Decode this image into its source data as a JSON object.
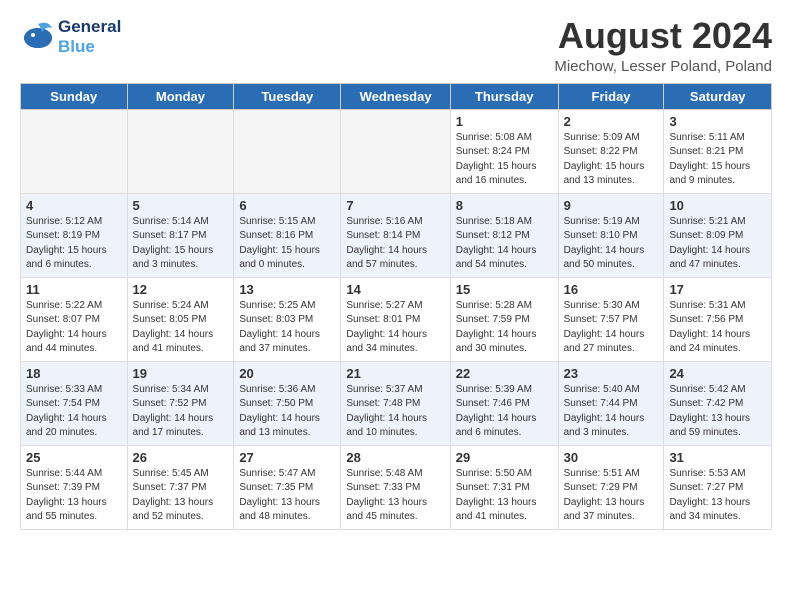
{
  "header": {
    "logo_line1": "General",
    "logo_line2": "Blue",
    "title": "August 2024",
    "location": "Miechow, Lesser Poland, Poland"
  },
  "weekdays": [
    "Sunday",
    "Monday",
    "Tuesday",
    "Wednesday",
    "Thursday",
    "Friday",
    "Saturday"
  ],
  "weeks": [
    [
      {
        "day": "",
        "info": ""
      },
      {
        "day": "",
        "info": ""
      },
      {
        "day": "",
        "info": ""
      },
      {
        "day": "",
        "info": ""
      },
      {
        "day": "1",
        "info": "Sunrise: 5:08 AM\nSunset: 8:24 PM\nDaylight: 15 hours\nand 16 minutes."
      },
      {
        "day": "2",
        "info": "Sunrise: 5:09 AM\nSunset: 8:22 PM\nDaylight: 15 hours\nand 13 minutes."
      },
      {
        "day": "3",
        "info": "Sunrise: 5:11 AM\nSunset: 8:21 PM\nDaylight: 15 hours\nand 9 minutes."
      }
    ],
    [
      {
        "day": "4",
        "info": "Sunrise: 5:12 AM\nSunset: 8:19 PM\nDaylight: 15 hours\nand 6 minutes."
      },
      {
        "day": "5",
        "info": "Sunrise: 5:14 AM\nSunset: 8:17 PM\nDaylight: 15 hours\nand 3 minutes."
      },
      {
        "day": "6",
        "info": "Sunrise: 5:15 AM\nSunset: 8:16 PM\nDaylight: 15 hours\nand 0 minutes."
      },
      {
        "day": "7",
        "info": "Sunrise: 5:16 AM\nSunset: 8:14 PM\nDaylight: 14 hours\nand 57 minutes."
      },
      {
        "day": "8",
        "info": "Sunrise: 5:18 AM\nSunset: 8:12 PM\nDaylight: 14 hours\nand 54 minutes."
      },
      {
        "day": "9",
        "info": "Sunrise: 5:19 AM\nSunset: 8:10 PM\nDaylight: 14 hours\nand 50 minutes."
      },
      {
        "day": "10",
        "info": "Sunrise: 5:21 AM\nSunset: 8:09 PM\nDaylight: 14 hours\nand 47 minutes."
      }
    ],
    [
      {
        "day": "11",
        "info": "Sunrise: 5:22 AM\nSunset: 8:07 PM\nDaylight: 14 hours\nand 44 minutes."
      },
      {
        "day": "12",
        "info": "Sunrise: 5:24 AM\nSunset: 8:05 PM\nDaylight: 14 hours\nand 41 minutes."
      },
      {
        "day": "13",
        "info": "Sunrise: 5:25 AM\nSunset: 8:03 PM\nDaylight: 14 hours\nand 37 minutes."
      },
      {
        "day": "14",
        "info": "Sunrise: 5:27 AM\nSunset: 8:01 PM\nDaylight: 14 hours\nand 34 minutes."
      },
      {
        "day": "15",
        "info": "Sunrise: 5:28 AM\nSunset: 7:59 PM\nDaylight: 14 hours\nand 30 minutes."
      },
      {
        "day": "16",
        "info": "Sunrise: 5:30 AM\nSunset: 7:57 PM\nDaylight: 14 hours\nand 27 minutes."
      },
      {
        "day": "17",
        "info": "Sunrise: 5:31 AM\nSunset: 7:56 PM\nDaylight: 14 hours\nand 24 minutes."
      }
    ],
    [
      {
        "day": "18",
        "info": "Sunrise: 5:33 AM\nSunset: 7:54 PM\nDaylight: 14 hours\nand 20 minutes."
      },
      {
        "day": "19",
        "info": "Sunrise: 5:34 AM\nSunset: 7:52 PM\nDaylight: 14 hours\nand 17 minutes."
      },
      {
        "day": "20",
        "info": "Sunrise: 5:36 AM\nSunset: 7:50 PM\nDaylight: 14 hours\nand 13 minutes."
      },
      {
        "day": "21",
        "info": "Sunrise: 5:37 AM\nSunset: 7:48 PM\nDaylight: 14 hours\nand 10 minutes."
      },
      {
        "day": "22",
        "info": "Sunrise: 5:39 AM\nSunset: 7:46 PM\nDaylight: 14 hours\nand 6 minutes."
      },
      {
        "day": "23",
        "info": "Sunrise: 5:40 AM\nSunset: 7:44 PM\nDaylight: 14 hours\nand 3 minutes."
      },
      {
        "day": "24",
        "info": "Sunrise: 5:42 AM\nSunset: 7:42 PM\nDaylight: 13 hours\nand 59 minutes."
      }
    ],
    [
      {
        "day": "25",
        "info": "Sunrise: 5:44 AM\nSunset: 7:39 PM\nDaylight: 13 hours\nand 55 minutes."
      },
      {
        "day": "26",
        "info": "Sunrise: 5:45 AM\nSunset: 7:37 PM\nDaylight: 13 hours\nand 52 minutes."
      },
      {
        "day": "27",
        "info": "Sunrise: 5:47 AM\nSunset: 7:35 PM\nDaylight: 13 hours\nand 48 minutes."
      },
      {
        "day": "28",
        "info": "Sunrise: 5:48 AM\nSunset: 7:33 PM\nDaylight: 13 hours\nand 45 minutes."
      },
      {
        "day": "29",
        "info": "Sunrise: 5:50 AM\nSunset: 7:31 PM\nDaylight: 13 hours\nand 41 minutes."
      },
      {
        "day": "30",
        "info": "Sunrise: 5:51 AM\nSunset: 7:29 PM\nDaylight: 13 hours\nand 37 minutes."
      },
      {
        "day": "31",
        "info": "Sunrise: 5:53 AM\nSunset: 7:27 PM\nDaylight: 13 hours\nand 34 minutes."
      }
    ]
  ]
}
